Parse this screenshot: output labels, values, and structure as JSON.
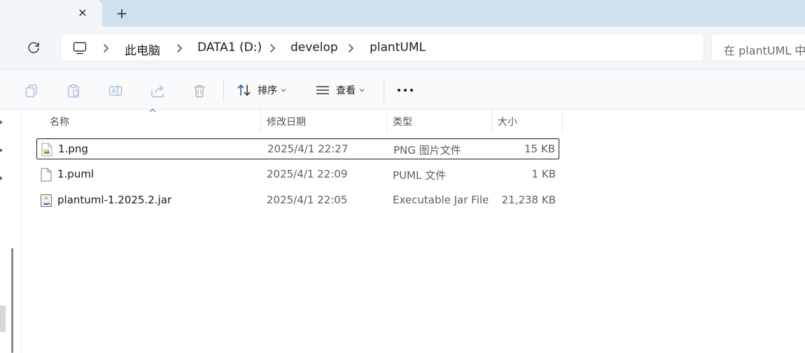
{
  "tabs": {
    "close_symbol": "✕",
    "new_tab_symbol": "+"
  },
  "address": {
    "breadcrumbs": [
      "此电脑",
      "DATA1 (D:)",
      "develop",
      "plantUML"
    ],
    "search_placeholder": "在 plantUML 中"
  },
  "toolbar": {
    "sort_label": "排序",
    "view_label": "查看",
    "icons": [
      "copy-icon",
      "paste-icon",
      "rename-icon",
      "share-icon",
      "delete-icon",
      "sort-icon",
      "view-icon",
      "more-icon"
    ]
  },
  "table": {
    "columns": [
      "名称",
      "修改日期",
      "类型",
      "大小"
    ],
    "rows": [
      {
        "name": "1.png",
        "date": "2025/4/1 22:27",
        "type": "PNG 图片文件",
        "size": "15 KB",
        "icon": "png-file-icon",
        "selected": true
      },
      {
        "name": "1.puml",
        "date": "2025/4/1 22:09",
        "type": "PUML 文件",
        "size": "1 KB",
        "icon": "generic-file-icon",
        "selected": false
      },
      {
        "name": "plantuml-1.2025.2.jar",
        "date": "2025/4/1 22:05",
        "type": "Executable Jar File",
        "size": "21,238 KB",
        "icon": "java-jar-icon",
        "selected": false
      }
    ]
  },
  "colors": {
    "accent": "#0067c0",
    "tabstrip": "#cfe0ee",
    "chrome": "#f3f6f9"
  }
}
